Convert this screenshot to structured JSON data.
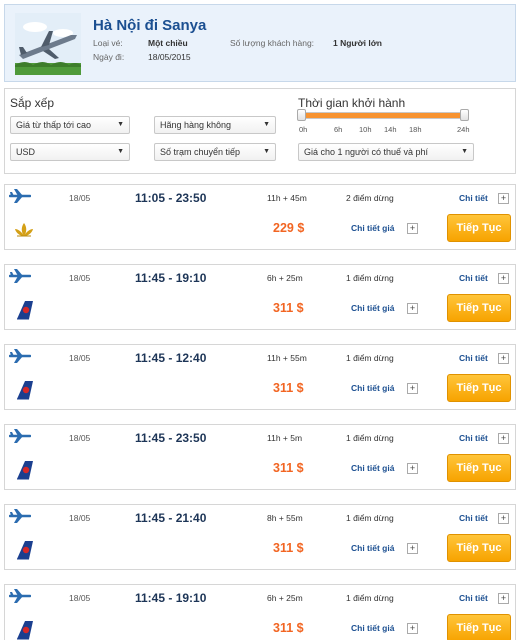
{
  "header": {
    "route": "Hà Nội đi Sanya",
    "ticket_type_label": "Loại vé:",
    "ticket_type_value": "Một chiều",
    "date_label": "Ngày đi:",
    "date_value": "18/05/2015",
    "passengers_label": "Số lượng khách hàng:",
    "passengers_value": "1 Người lớn"
  },
  "filters": {
    "sort_label": "Sắp xếp",
    "sort_select": "Giá từ thấp tới cao",
    "airline_select": "Hãng hàng không",
    "currency_select": "USD",
    "stops_select": "Số trạm chuyển tiếp",
    "departure_label": "Thời gian khởi hành",
    "price_mode_select": "Giá cho 1 người có thuế và phí",
    "slider_ticks": [
      "0h",
      "6h",
      "10h",
      "14h",
      "18h",
      "24h"
    ],
    "slider_range_hours": [
      0,
      24
    ]
  },
  "colors": {
    "accent_orange": "#f79331",
    "price_orange": "#f26522",
    "link_blue": "#1b4f91",
    "button_yellow": "#f7a300"
  },
  "flights": [
    {
      "date": "18/05",
      "time": "11:05 - 23:50",
      "duration": "11h + 45m",
      "stops": "2 điểm dừng",
      "detail": "Chi tiết",
      "price": "229 $",
      "price_detail": "Chi tiết giá",
      "button": "Tiếp Tục",
      "airline_logo": "lotus-logo-icon"
    },
    {
      "date": "18/05",
      "time": "11:45 - 19:10",
      "duration": "6h + 25m",
      "stops": "1 điểm dừng",
      "detail": "Chi tiết",
      "price": "311 $",
      "price_detail": "Chi tiết giá",
      "button": "Tiếp Tục",
      "airline_logo": "tail-fin-logo-icon"
    },
    {
      "date": "18/05",
      "time": "11:45 - 12:40",
      "duration": "11h + 55m",
      "stops": "1 điểm dừng",
      "detail": "Chi tiết",
      "price": "311 $",
      "price_detail": "Chi tiết giá",
      "button": "Tiếp Tục",
      "airline_logo": "tail-fin-logo-icon"
    },
    {
      "date": "18/05",
      "time": "11:45 - 23:50",
      "duration": "11h + 5m",
      "stops": "1 điểm dừng",
      "detail": "Chi tiết",
      "price": "311 $",
      "price_detail": "Chi tiết giá",
      "button": "Tiếp Tục",
      "airline_logo": "tail-fin-logo-icon"
    },
    {
      "date": "18/05",
      "time": "11:45 - 21:40",
      "duration": "8h + 55m",
      "stops": "1 điểm dừng",
      "detail": "Chi tiết",
      "price": "311 $",
      "price_detail": "Chi tiết giá",
      "button": "Tiếp Tục",
      "airline_logo": "tail-fin-logo-icon"
    },
    {
      "date": "18/05",
      "time": "11:45 - 19:10",
      "duration": "6h + 25m",
      "stops": "1 điểm dừng",
      "detail": "Chi tiết",
      "price": "311 $",
      "price_detail": "Chi tiết giá",
      "button": "Tiếp Tục",
      "airline_logo": "tail-fin-logo-icon"
    }
  ]
}
